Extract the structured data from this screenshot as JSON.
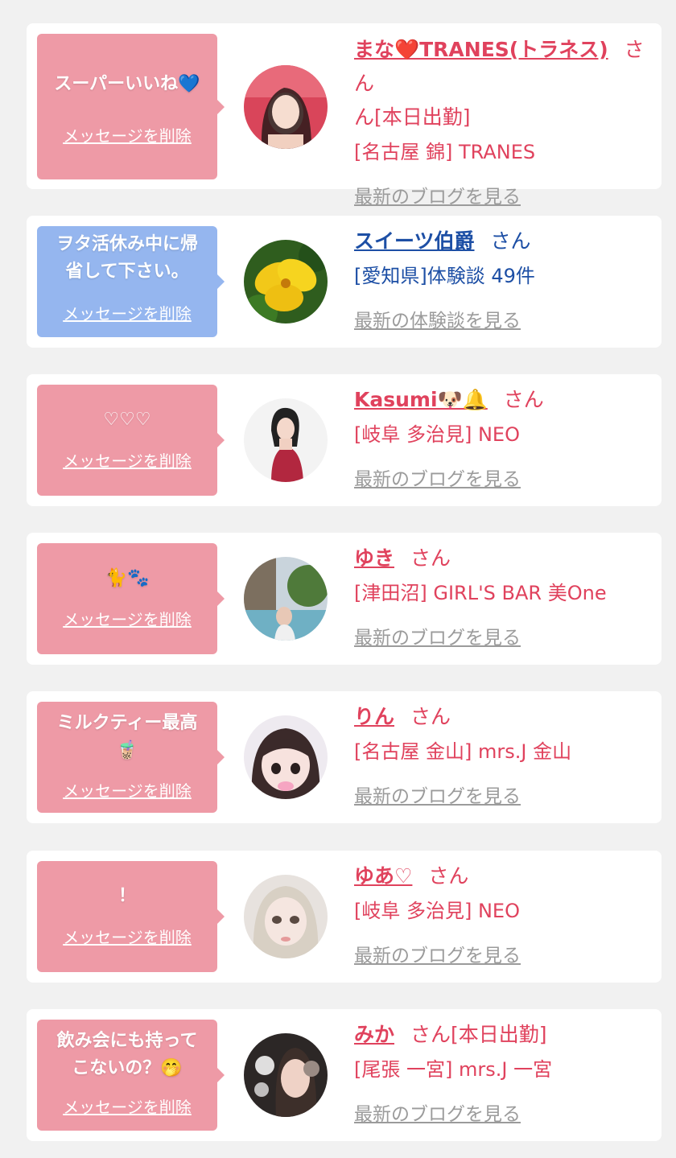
{
  "cards": [
    {
      "message": "スーパーいいね💙",
      "delete_label": "メッセージを削除",
      "name": "まな❤️TRANES(トラネス)",
      "san": "さん",
      "name_suffix": "ん[本日出勤]",
      "shop": "[名古屋 錦] TRANES",
      "link": "最新のブログを見る"
    },
    {
      "message": "ヲタ活休み中に帰\n省して下さい。",
      "delete_label": "メッセージを削除",
      "name": "スイーツ伯爵",
      "san": "さん",
      "shop": "[愛知県]体験談 49件",
      "link": "最新の体験談を見る"
    },
    {
      "message": "♡♡♡",
      "delete_label": "メッセージを削除",
      "name": "Kasumi🐶🔔",
      "san": "さん",
      "shop": "[岐阜 多治見] NEO",
      "link": "最新のブログを見る"
    },
    {
      "message": "🐈🐾",
      "delete_label": "メッセージを削除",
      "name": "ゆき",
      "san": "さん",
      "shop": "[津田沼] GIRL'S BAR 美One",
      "link": "最新のブログを見る"
    },
    {
      "message": "ミルクティー最高\n🧋",
      "delete_label": "メッセージを削除",
      "name": "りん",
      "san": "さん",
      "shop": "[名古屋 金山] mrs.J 金山",
      "link": "最新のブログを見る"
    },
    {
      "message": "！",
      "delete_label": "メッセージを削除",
      "name": "ゆあ♡",
      "san": "さん",
      "shop": "[岐阜 多治見] NEO",
      "link": "最新のブログを見る"
    },
    {
      "message": "飲み会にも持って\nこないの？🤭",
      "delete_label": "メッセージを削除",
      "name": "みか",
      "san": "さん[本日出勤]",
      "shop": "[尾張 一宮] mrs.J 一宮",
      "link": "最新のブログを見る"
    }
  ],
  "colors": {
    "pink_bubble": "#ee9aa6",
    "blue_bubble": "#95b6ef",
    "pink_text": "#e0425d",
    "blue_text": "#1d4fa5",
    "link_gray": "#9b9b9b"
  }
}
